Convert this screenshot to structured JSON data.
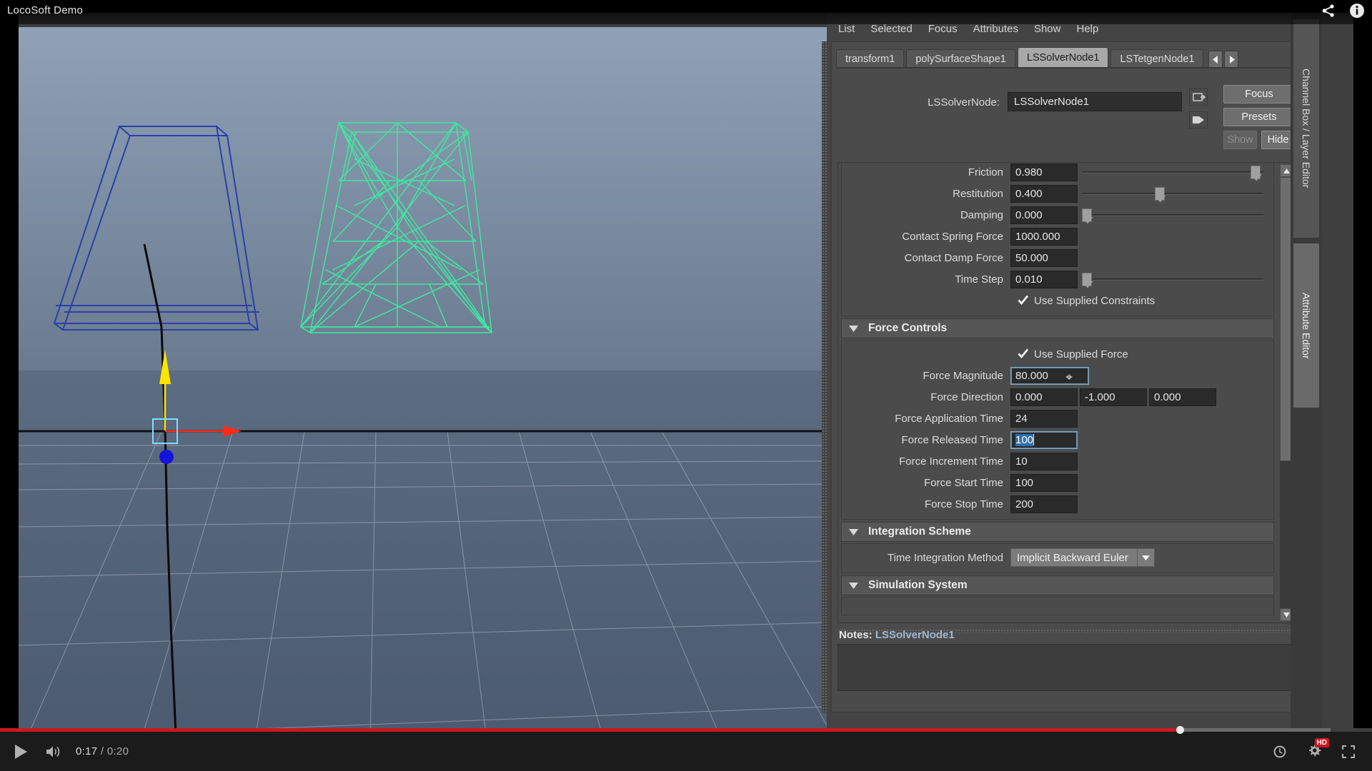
{
  "player": {
    "video_title": "LocoSoft Demo",
    "current_time": "0:17",
    "total_time": "0:20",
    "time_separator": "/",
    "play_icon": "play-icon",
    "volume_icon": "volume-icon",
    "watch_later_icon": "clock-icon",
    "settings_icon": "gear-icon",
    "quality_badge": "HD",
    "size_icon": "expand-icon",
    "share_icon": "share-icon",
    "info_icon": "info-icon",
    "progress_percent": 86,
    "loaded_percent": 97
  },
  "viewport": {
    "toolbar_icons": [
      "perspective-icon",
      "panel-icon",
      "wrench-icon"
    ],
    "objects": [
      {
        "name": "source-cage-wireframe",
        "color": "#2c3fa8"
      },
      {
        "name": "tetrahedral-mesh-wireframe",
        "color": "#40e6a0"
      }
    ],
    "manipulator": {
      "name": "move-manipulator",
      "axis_y_color": "#ffe400",
      "axis_x_color": "#ff2a15",
      "axis_z_color": "#1414d8",
      "center_color": "#7fdcff"
    }
  },
  "attribute_editor": {
    "window_title": "Attribute Editor",
    "menu": [
      "List",
      "Selected",
      "Focus",
      "Attributes",
      "Show",
      "Help"
    ],
    "tabs": [
      {
        "label": "transform1",
        "active": false
      },
      {
        "label": "polySurfaceShape1",
        "active": false
      },
      {
        "label": "LSSolverNode1",
        "active": true
      },
      {
        "label": "LSTetgenNode1",
        "active": false
      }
    ],
    "tab_prev_icon": "chevron-left-icon",
    "tab_next_icon": "chevron-right-icon",
    "node_type_label": "LSSolverNode:",
    "node_name": "LSSolverNode1",
    "buttons": {
      "focus": "Focus",
      "presets": "Presets",
      "show": "Show",
      "hide": "Hide"
    },
    "sections": [
      {
        "id": "solver-attributes",
        "type": "fields",
        "rows": [
          {
            "label": "Friction",
            "values": [
              "0.980"
            ],
            "slider": 93
          },
          {
            "label": "Restitution",
            "values": [
              "0.400"
            ],
            "slider": 40
          },
          {
            "label": "Damping",
            "values": [
              "0.000"
            ],
            "slider": 1
          },
          {
            "label": "Contact Spring Force",
            "values": [
              "1000.000"
            ],
            "slider": null
          },
          {
            "label": "Contact Damp Force",
            "values": [
              "50.000"
            ],
            "slider": null
          },
          {
            "label": "Time Step",
            "values": [
              "0.010"
            ],
            "slider": 1
          }
        ],
        "checkboxes": [
          {
            "label": "Use Supplied Constraints",
            "checked": true
          }
        ]
      },
      {
        "id": "force-controls",
        "type": "group",
        "title": "Force Controls",
        "collapsed": false,
        "checkboxes": [
          {
            "label": "Use Supplied Force",
            "checked": true
          }
        ],
        "rows": [
          {
            "label": "Force Magnitude",
            "values": [
              "80.000"
            ],
            "focused": true,
            "cursor": true
          },
          {
            "label": "Force Direction",
            "values": [
              "0.000",
              "-1.000",
              "0.000"
            ]
          },
          {
            "label": "Force Application Time",
            "values": [
              "24"
            ]
          },
          {
            "label": "Force Released Time",
            "values": [
              "100"
            ],
            "focused": true,
            "selected": true,
            "caret": true
          },
          {
            "label": "Force Increment Time",
            "values": [
              "10"
            ]
          },
          {
            "label": "Force Start Time",
            "values": [
              "100"
            ]
          },
          {
            "label": "Force Stop Time",
            "values": [
              "200"
            ]
          }
        ]
      },
      {
        "id": "integration-scheme",
        "type": "group",
        "title": "Integration Scheme",
        "collapsed": false,
        "combo": {
          "label": "Time Integration Method",
          "value": "Implicit Backward Euler",
          "arrow_icon": "chevron-down-icon"
        }
      },
      {
        "id": "simulation-system",
        "type": "group",
        "title": "Simulation System",
        "collapsed": false
      }
    ],
    "notes_label": "Notes:",
    "notes_node": "LSSolverNode1",
    "scroll_up_icon": "scroll-up-icon",
    "scroll_down_icon": "scroll-down-icon"
  },
  "side_tabs": [
    {
      "label": "Channel Box / Layer Editor",
      "active": false
    },
    {
      "label": "Attribute Editor",
      "active": true
    }
  ]
}
